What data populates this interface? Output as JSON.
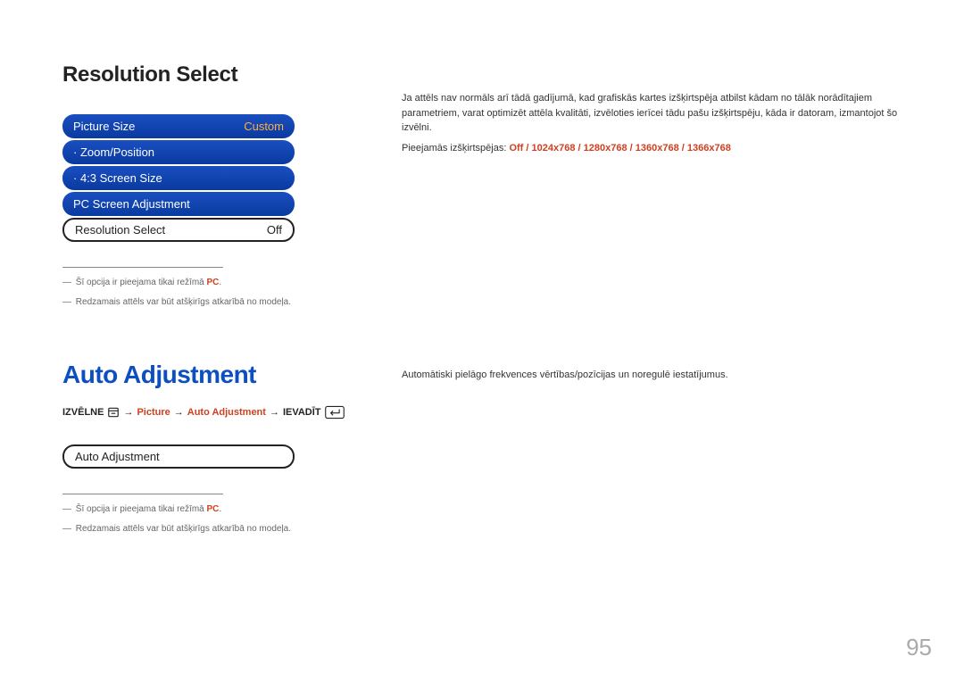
{
  "section1": {
    "heading": "Resolution Select",
    "menu": {
      "items": [
        {
          "label": "Picture Size",
          "value": "Custom",
          "style": "blue"
        },
        {
          "label": "· Zoom/Position",
          "value": "",
          "style": "blue"
        },
        {
          "label": "· 4:3 Screen Size",
          "value": "",
          "style": "blue"
        },
        {
          "label": "PC Screen Adjustment",
          "value": "",
          "style": "blue"
        },
        {
          "label": "Resolution Select",
          "value": "Off",
          "style": "outline"
        }
      ]
    },
    "footnotes": [
      {
        "prefix": "―",
        "text_a": "Šī opcija ir pieejama tikai režīmā ",
        "pc": "PC",
        "text_b": "."
      },
      {
        "prefix": "―",
        "text_a": "Redzamais attēls var būt atšķirīgs atkarībā no modeļa.",
        "pc": "",
        "text_b": ""
      }
    ],
    "right": {
      "para": "Ja attēls nav normāls arī tādā gadījumā, kad grafiskās kartes izšķirtspēja atbilst kādam no tālāk norādītajiem parametriem, varat optimizēt attēla kvalitāti, izvēloties ierīcei tādu pašu izšķirtspēju, kāda ir datoram, izmantojot šo izvēlni.",
      "res_label": "Pieejamās izšķirtspējas: ",
      "res_values": [
        "Off",
        "1024x768",
        "1280x768",
        "1360x768",
        "1366x768"
      ],
      "sep": " / "
    }
  },
  "section2": {
    "heading": "Auto Adjustment",
    "path": {
      "p1": "IZVĒLNE",
      "arrow": "→",
      "p2": "Picture",
      "p3": "Auto Adjustment",
      "p4": "IEVADĪT"
    },
    "box_label": "Auto Adjustment",
    "footnotes": [
      {
        "prefix": "―",
        "text_a": "Šī opcija ir pieejama tikai režīmā ",
        "pc": "PC",
        "text_b": "."
      },
      {
        "prefix": "―",
        "text_a": "Redzamais attēls var būt atšķirīgs atkarībā no modeļa.",
        "pc": "",
        "text_b": ""
      }
    ],
    "right": {
      "para": "Automātiski pielāgo frekvences vērtības/pozīcijas un noregulē iestatījumus."
    }
  },
  "page_number": "95"
}
